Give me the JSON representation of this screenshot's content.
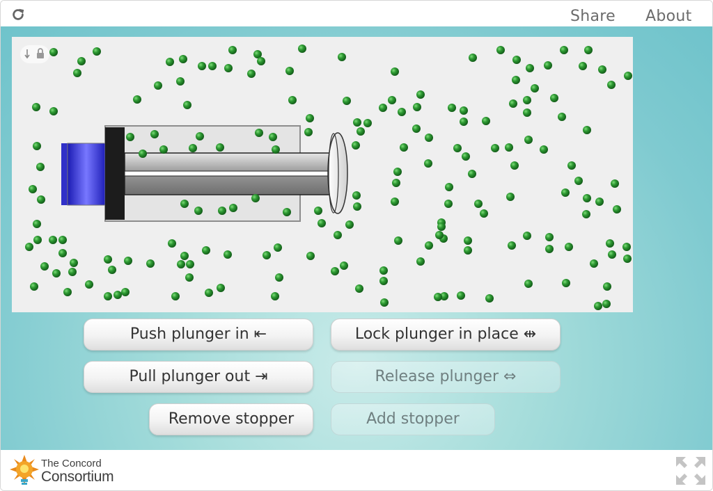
{
  "header": {
    "share_label": "Share",
    "about_label": "About",
    "reload_icon": "reload-icon"
  },
  "simulation": {
    "background": "#efefef",
    "particle_color": "#2e9a33",
    "plunger_cap_color": "#3a3ad6",
    "controls_icon": "download-lock-icon"
  },
  "buttons": {
    "push": "Push plunger in ⇤",
    "lock": "Lock plunger in place ⇹",
    "pull": "Pull plunger out ⇥",
    "release": "Release plunger ⇔",
    "remove_stopper": "Remove stopper",
    "add_stopper": "Add stopper"
  },
  "footer": {
    "logo_line1": "The Concord",
    "logo_line2": "Consortium",
    "fullscreen_icon": "fullscreen-icon"
  }
}
